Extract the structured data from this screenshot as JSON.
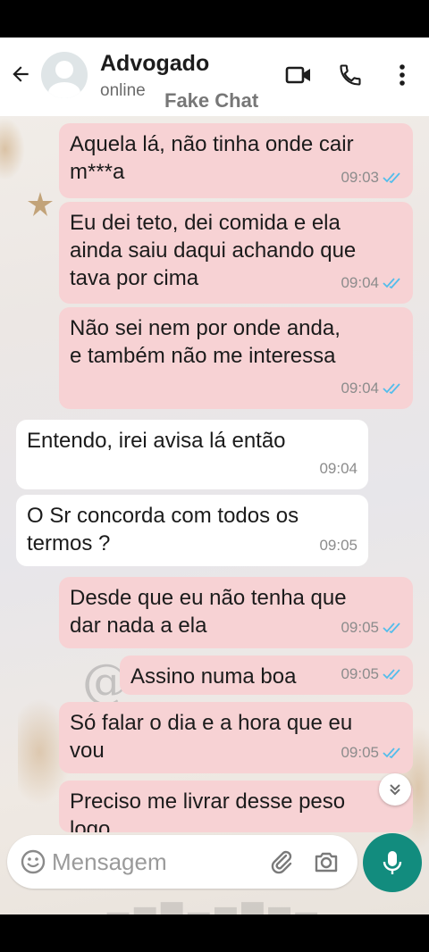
{
  "header": {
    "contact_name": "Advogado",
    "status": "online",
    "watermark": "Fake Chat"
  },
  "icons": {
    "back": "arrow-left-icon",
    "video": "video-call-icon",
    "call": "phone-icon",
    "menu": "more-vert-icon",
    "emoji": "emoji-icon",
    "attach": "paperclip-icon",
    "camera": "camera-icon",
    "mic": "microphone-icon",
    "scroll": "double-chevron-down-icon"
  },
  "colors": {
    "outgoing_bubble": "#f7d2d4",
    "incoming_bubble": "#ffffff",
    "read_tick": "#53bdeb",
    "mic_button": "#128c7e"
  },
  "messages": [
    {
      "direction": "out",
      "text": "Aquela lá, não tinha onde cair\nm***a",
      "time": "09:03",
      "read": true
    },
    {
      "direction": "out",
      "text": "Eu dei teto, dei comida e ela\nainda saiu daqui achando que\ntava por cima",
      "time": "09:04",
      "read": true
    },
    {
      "direction": "out",
      "text": "Não sei nem por onde anda,\ne também não me interessa",
      "time": "09:04",
      "read": true
    },
    {
      "direction": "in",
      "text": "Entendo, irei avisa lá então",
      "time": "09:04"
    },
    {
      "direction": "in",
      "text": "O Sr concorda com todos os\ntermos ?",
      "time": "09:05"
    },
    {
      "direction": "out",
      "text": "Desde que eu não tenha que\ndar nada a ela",
      "time": "09:05",
      "read": true
    },
    {
      "direction": "out",
      "text": "Assino numa boa",
      "time": "09:05",
      "read": true
    },
    {
      "direction": "out",
      "text": "Só falar o dia e a hora que eu\nvou",
      "time": "09:05",
      "read": true
    },
    {
      "direction": "out",
      "text": "Preciso me livrar desse peso\nlogo",
      "time": ""
    }
  ],
  "input": {
    "placeholder": "Mensagem"
  }
}
